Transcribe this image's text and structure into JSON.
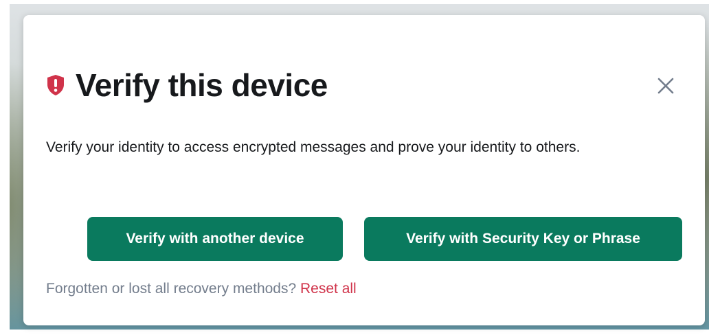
{
  "dialog": {
    "title": "Verify this device",
    "description": "Verify your identity to access encrypted messages and prove your identity to others.",
    "icons": {
      "title_icon": "shield-warning-icon",
      "close_icon": "close-icon"
    },
    "buttons": {
      "another_device": "Verify with another device",
      "security_key": "Verify with Security Key or Phrase"
    },
    "footer": {
      "prompt": "Forgotten or lost all recovery methods?",
      "reset_link": "Reset all"
    },
    "colors": {
      "accent": "#0a7a5e",
      "alert": "#d0334a",
      "text": "#17191c",
      "muted": "#737d8c"
    }
  }
}
